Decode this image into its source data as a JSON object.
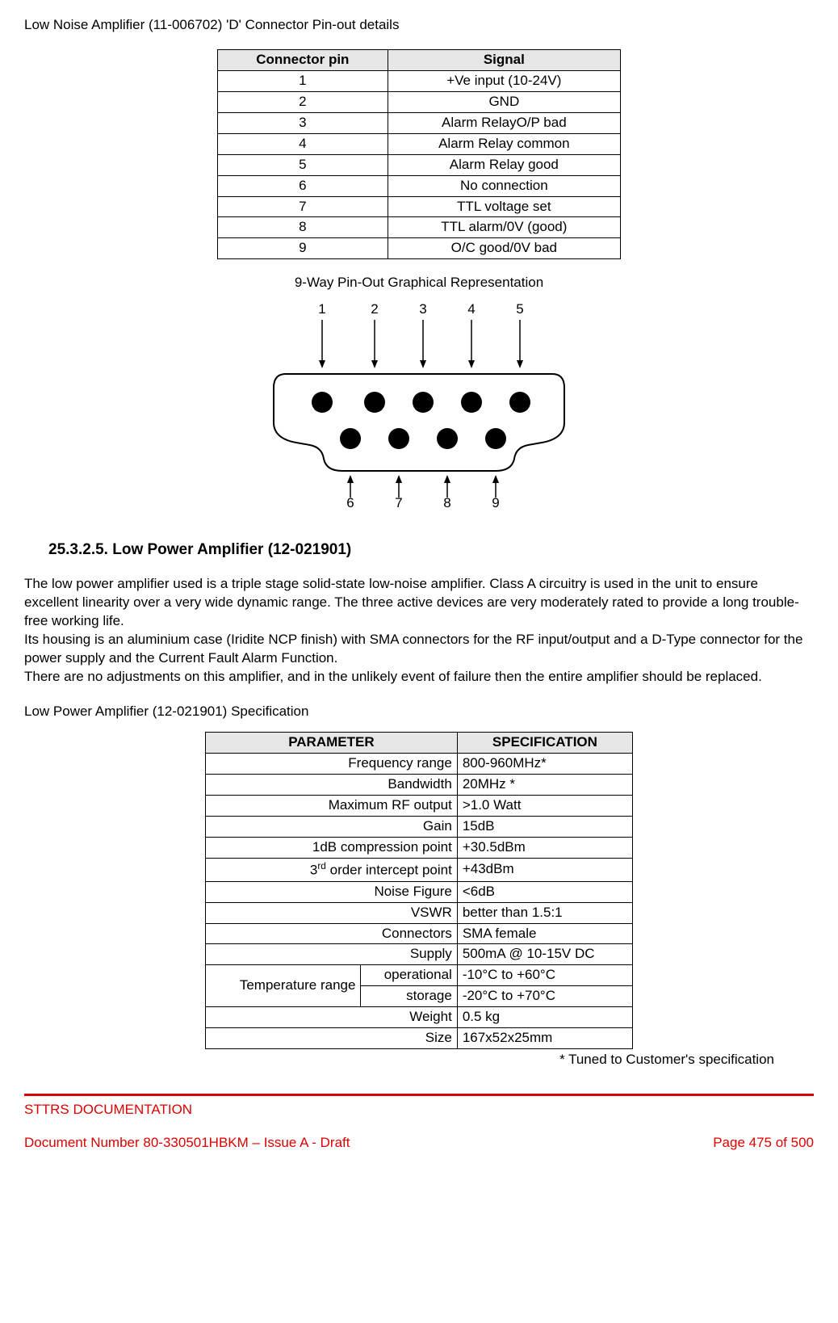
{
  "titleLine": "Low Noise Amplifier (11-006702) 'D' Connector Pin-out details",
  "pinoutTable": {
    "headers": [
      "Connector pin",
      "Signal"
    ],
    "rows": [
      [
        "1",
        "+Ve input (10-24V)"
      ],
      [
        "2",
        "GND"
      ],
      [
        "3",
        "Alarm RelayO/P bad"
      ],
      [
        "4",
        "Alarm Relay common"
      ],
      [
        "5",
        "Alarm Relay good"
      ],
      [
        "6",
        "No connection"
      ],
      [
        "7",
        "TTL voltage set"
      ],
      [
        "8",
        "TTL alarm/0V (good)"
      ],
      [
        "9",
        "O/C good/0V bad"
      ]
    ]
  },
  "diagram": {
    "caption": "9-Way Pin-Out Graphical Representation",
    "topLabels": [
      "1",
      "2",
      "3",
      "4",
      "5"
    ],
    "bottomLabels": [
      "6",
      "7",
      "8",
      "9"
    ]
  },
  "sectionHeading": "25.3.2.5.   Low Power Amplifier (12-021901)",
  "bodyText": "The low power amplifier used is a triple stage solid-state low-noise amplifier. Class A circuitry is used in the unit to ensure excellent linearity over a very wide dynamic range. The three active devices are very moderately rated to provide a long trouble-free working life.\nIts housing is an aluminium case (Iridite NCP finish) with SMA connectors for the RF input/output and a D-Type connector for the power supply and the Current Fault Alarm Function.\nThere are no adjustments on this amplifier, and in the unlikely event of failure then the entire amplifier should be replaced.",
  "specCaption": "Low Power Amplifier (12-021901) Specification",
  "specTable": {
    "headers": [
      "PARAMETER",
      "SPECIFICATION"
    ],
    "rows": [
      {
        "param": "Frequency range",
        "value": "800-960MHz*"
      },
      {
        "param": "Bandwidth",
        "value": "20MHz *"
      },
      {
        "param": "Maximum RF output",
        "value": ">1.0 Watt"
      },
      {
        "param": "Gain",
        "value": "15dB"
      },
      {
        "param": "1dB compression point",
        "value": "+30.5dBm"
      },
      {
        "param_html": "3<sup>rd</sup> order intercept point",
        "value": "+43dBm"
      },
      {
        "param": "Noise Figure",
        "value": "<6dB"
      },
      {
        "param": "VSWR",
        "value": "better than 1.5:1"
      },
      {
        "param": "Connectors",
        "value": "SMA female"
      },
      {
        "param": "Supply",
        "value": "500mA @ 10-15V DC"
      }
    ],
    "tempHeader": "Temperature range",
    "tempRows": [
      {
        "sub": "operational",
        "value": "-10°C to +60°C"
      },
      {
        "sub": "storage",
        "value": "-20°C to +70°C"
      }
    ],
    "tailRows": [
      {
        "param": "Weight",
        "value": "0.5 kg"
      },
      {
        "param": "Size",
        "value": "167x52x25mm"
      }
    ]
  },
  "footnote": "* Tuned to Customer's specification",
  "footer": {
    "top": "STTRS DOCUMENTATION",
    "left": "Document Number 80-330501HBKM – Issue A - Draft",
    "right": "Page 475 of 500"
  },
  "chart_data": {
    "type": "table",
    "description": "DB-9 connector 9-way pin-out",
    "pins": [
      {
        "pin": 1,
        "row": "top",
        "signal": "+Ve input (10-24V)"
      },
      {
        "pin": 2,
        "row": "top",
        "signal": "GND"
      },
      {
        "pin": 3,
        "row": "top",
        "signal": "Alarm RelayO/P bad"
      },
      {
        "pin": 4,
        "row": "top",
        "signal": "Alarm Relay common"
      },
      {
        "pin": 5,
        "row": "top",
        "signal": "Alarm Relay good"
      },
      {
        "pin": 6,
        "row": "bottom",
        "signal": "No connection"
      },
      {
        "pin": 7,
        "row": "bottom",
        "signal": "TTL voltage set"
      },
      {
        "pin": 8,
        "row": "bottom",
        "signal": "TTL alarm/0V (good)"
      },
      {
        "pin": 9,
        "row": "bottom",
        "signal": "O/C good/0V bad"
      }
    ]
  }
}
